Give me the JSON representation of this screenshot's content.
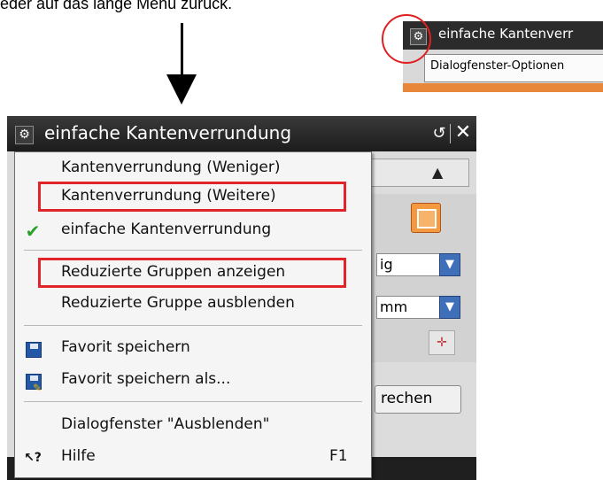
{
  "caption": "eder auf das lange Menü zurück.",
  "inset": {
    "title": "einfache Kantenverr",
    "menu_label": "Dialogfenster-Optionen"
  },
  "dialog": {
    "title": "einfache Kantenverrundung",
    "field1_value": "ig",
    "field2_value": "mm",
    "cancel_label": "rechen"
  },
  "menu": {
    "items": [
      {
        "label": "Kantenverrundung (Weniger)",
        "icon": ""
      },
      {
        "label": "Kantenverrundung (Weitere)",
        "icon": "",
        "highlighted": true
      },
      {
        "label": "einfache Kantenverrundung",
        "icon": "checkmark-icon",
        "checked": true
      },
      {
        "label": "Reduzierte Gruppen anzeigen",
        "icon": "",
        "highlighted": true
      },
      {
        "label": "Reduzierte Gruppe ausblenden",
        "icon": ""
      },
      {
        "label": "Favorit speichern",
        "icon": "floppy-disk-icon"
      },
      {
        "label": "Favorit speichern als...",
        "icon": "floppy-disk-edit-icon"
      },
      {
        "label": "Dialogfenster \"Ausblenden\"",
        "icon": ""
      },
      {
        "label": "Hilfe",
        "icon": "help-pointer-icon",
        "shortcut": "F1"
      }
    ]
  },
  "colors": {
    "highlight_border": "#e0242a",
    "titlebar": "#1f1f1f",
    "accent_orange": "#f39a40",
    "check_green": "#2aa12a"
  }
}
